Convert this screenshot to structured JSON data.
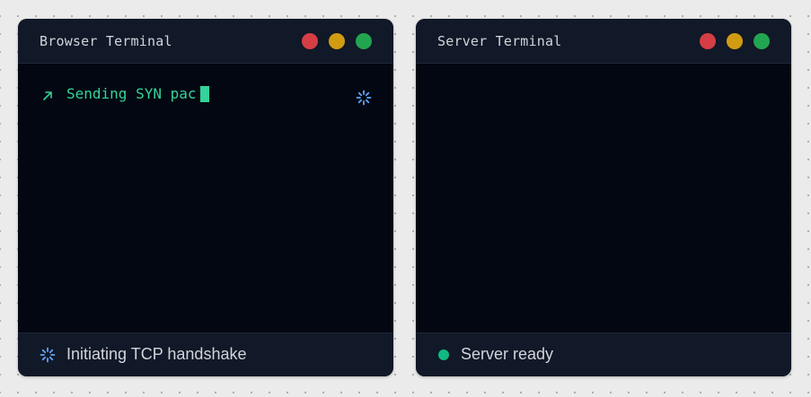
{
  "browser_terminal": {
    "title": "Browser Terminal",
    "output_line": "Sending SYN pac",
    "status": "Initiating TCP handshake",
    "status_icon": "spinner-icon",
    "line_icon": "arrow-up-right-icon"
  },
  "server_terminal": {
    "title": "Server Terminal",
    "status": "Server ready",
    "status_icon": "status-dot-icon"
  },
  "colors": {
    "window_bg": "#030712",
    "header_bg": "#111827",
    "text_green": "#34d399",
    "spinner_blue": "#60a5fa",
    "dot_red": "#d63e45",
    "dot_yellow": "#d29c12",
    "dot_green": "#22a550",
    "ready_green": "#10b981"
  }
}
